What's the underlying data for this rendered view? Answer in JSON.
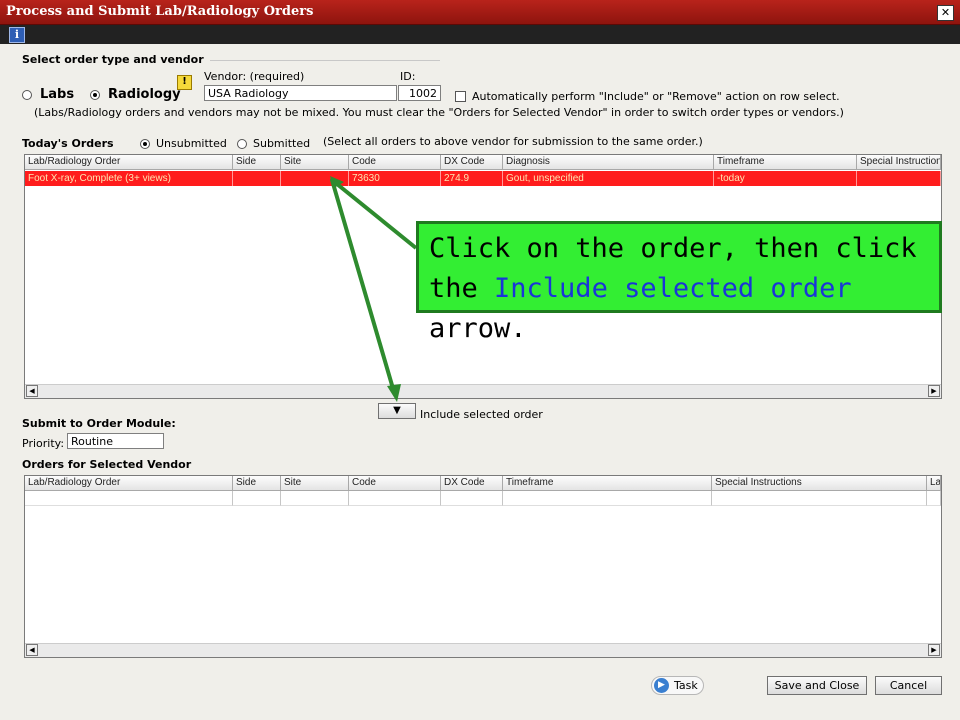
{
  "window": {
    "title": "Process and Submit Lab/Radiology Orders",
    "close_glyph": "✕",
    "info_glyph": "i"
  },
  "order_type": {
    "section_title": "Select order type and vendor",
    "labs_label": "Labs",
    "radiology_label": "Radiology",
    "selected": "Radiology",
    "vendor_label": "Vendor: (required)",
    "vendor_value": "USA Radiology",
    "id_label": "ID:",
    "id_value": "1002",
    "auto_label": "Automatically perform \"Include\" or \"Remove\" action on row select.",
    "auto_checked": false,
    "note": "(Labs/Radiology orders and vendors may not be mixed. You must clear the \"Orders for Selected Vendor\" in order to switch order types or vendors.)",
    "warning_glyph": "!"
  },
  "todays_orders": {
    "title": "Today's Orders",
    "unsubmitted_label": "Unsubmitted",
    "submitted_label": "Submitted",
    "selected": "Unsubmitted",
    "hint": "(Select all orders to above vendor for submission to the same order.)",
    "columns": [
      "Lab/Radiology Order",
      "Side",
      "Site",
      "Code",
      "DX Code",
      "Diagnosis",
      "Timeframe",
      "Special Instructions"
    ],
    "rows": [
      {
        "order": "Foot X-ray, Complete (3+ views)",
        "side": "",
        "site": "",
        "code": "73630",
        "dx_code": "274.9",
        "diagnosis": "Gout, unspecified",
        "timeframe": "-today",
        "instructions": ""
      }
    ]
  },
  "include_button": {
    "label": "Include selected order",
    "glyph": "▼"
  },
  "submit": {
    "title": "Submit to Order Module:",
    "priority_label": "Priority:",
    "priority_value": "Routine"
  },
  "vendor_orders": {
    "title": "Orders for Selected Vendor",
    "columns": [
      "Lab/Radiology Order",
      "Side",
      "Site",
      "Code",
      "DX Code",
      "Timeframe",
      "Special Instructions",
      "La"
    ]
  },
  "scroll": {
    "left": "◀",
    "right": "▶"
  },
  "footer": {
    "task_label": "Task",
    "task_glyph": "▶",
    "save_label": "Save and Close",
    "cancel_label": "Cancel"
  },
  "callout": {
    "text_before": "Click on the order, then click the ",
    "highlight": "Include selected order",
    "text_after": " arrow."
  },
  "colors": {
    "selected_row": "#ff1c1c",
    "titlebar": "#a01a14",
    "callout_bg": "#33ee33",
    "callout_border": "#1f7a1f",
    "arrow": "#2e8b2e",
    "highlight_text": "#1a35d8"
  }
}
